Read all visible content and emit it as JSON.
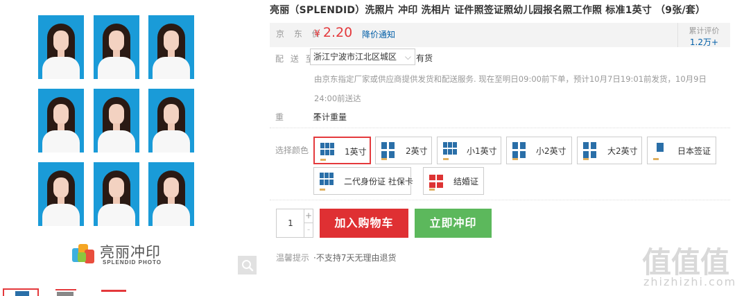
{
  "gallery": {
    "brand_cn": "亮丽冲印",
    "brand_en": "SPLENDID PHOTO",
    "zoom_icon": "magnifier-icon",
    "thumbnails": [
      "thumb-1",
      "thumb-2",
      "thumb-3"
    ]
  },
  "product": {
    "title": "亮丽（SPLENDID）洗照片 冲印 洗相片 证件照签证照幼儿园报名照工作照 标准1英寸 （9张/套）"
  },
  "price": {
    "label": "京 东 价",
    "currency": "¥",
    "value": "2.20",
    "notify": "降价通知"
  },
  "rating": {
    "label": "累计评价",
    "count": "1.2万+"
  },
  "shipping": {
    "label": "配 送 至",
    "address": "浙江宁波市江北区城区",
    "stock": "有货",
    "note": "由京东指定厂家或供应商提供发货和配送服务. 现在至明日09:00前下单，预计10月7日19:01前发货，10月9日24:00前送达"
  },
  "weight": {
    "label": "重 量",
    "value": "不计重量"
  },
  "color": {
    "label": "选择颜色",
    "options": [
      "1英寸",
      "2英寸",
      "小1英寸",
      "小2英寸",
      "大2英寸",
      "日本签证",
      "二代身份证 社保卡",
      "结婚证"
    ],
    "selected": "1英寸"
  },
  "purchase": {
    "quantity": "1",
    "plus": "+",
    "minus": "-",
    "cart_button": "加入购物车",
    "buy_button": "立即冲印"
  },
  "tips": {
    "label": "温馨提示",
    "value": "·不支持7天无理由退货"
  },
  "watermark": {
    "glyphs": "值值值",
    "text": "zhizhizhi.com"
  },
  "colors": {
    "accent_red": "#e4393c",
    "cart_red": "#df3033",
    "buy_green": "#5cb85c",
    "link_blue": "#005ea7",
    "photo_bg_blue": "#1a9bd8"
  }
}
